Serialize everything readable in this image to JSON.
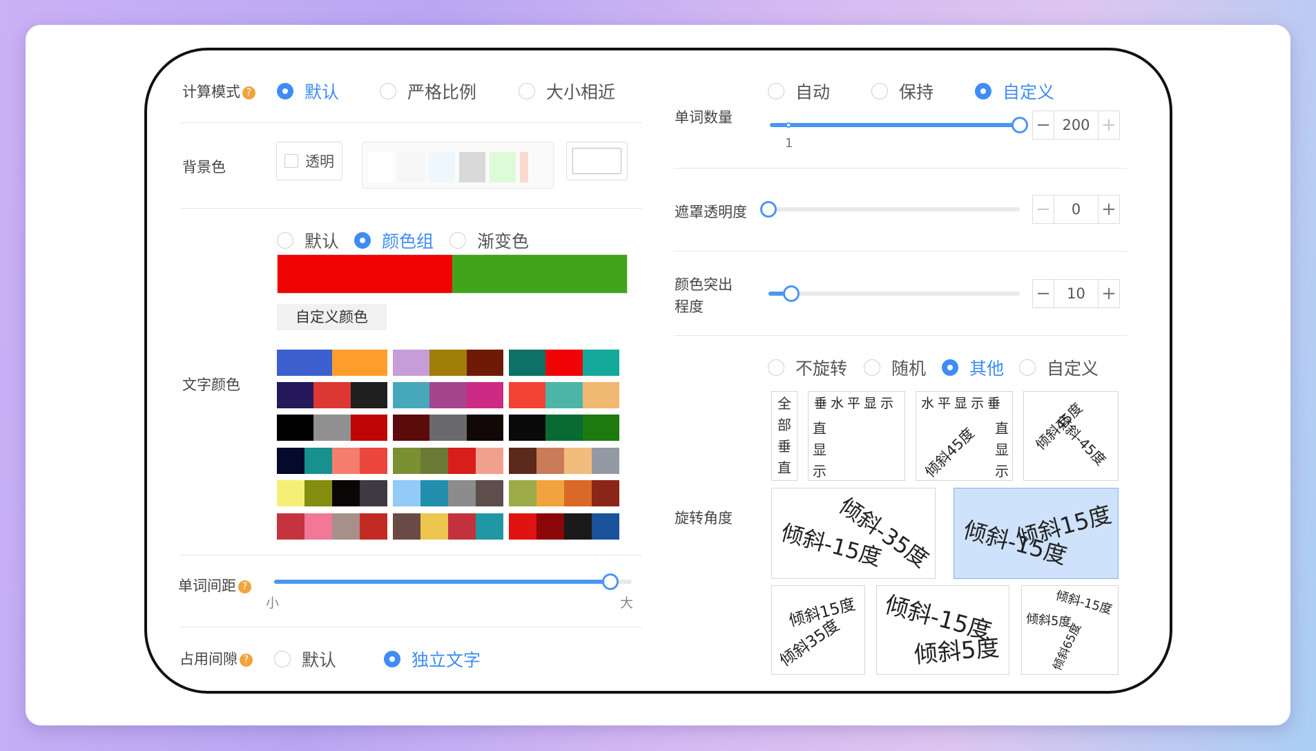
{
  "calc_mode": {
    "label": "计算模式",
    "options": [
      {
        "label": "默认",
        "selected": true
      },
      {
        "label": "严格比例",
        "selected": false
      },
      {
        "label": "大小相近",
        "selected": false
      }
    ]
  },
  "background": {
    "label": "背景色",
    "transparent_label": "透明",
    "swatches": [
      "#ffffff",
      "#f6f6f6",
      "#eef7fd",
      "#d9d9d9",
      "#ddfbd7",
      "#fbd9cf"
    ]
  },
  "text_color": {
    "label": "文字颜色",
    "options": [
      {
        "label": "默认",
        "selected": false
      },
      {
        "label": "颜色组",
        "selected": true
      },
      {
        "label": "渐变色",
        "selected": false
      }
    ],
    "current_colors": [
      "#f20303",
      "#40a51b"
    ],
    "custom_button": "自定义颜色",
    "palettes": [
      [
        "#3c5fcf",
        "#3c5fcf",
        "#ff9d2b",
        "#ff9d2b"
      ],
      [
        "#c79dd8",
        "#a07e08",
        "#6f1a06"
      ],
      [
        "#0e7168",
        "#f20306",
        "#14a99a"
      ],
      [
        "#25195c",
        "#dc3732",
        "#1f1f1f"
      ],
      [
        "#47a8bb",
        "#a4458e",
        "#cc2a85"
      ],
      [
        "#f34335",
        "#4cb5a7",
        "#f0b870"
      ],
      [
        "#010101",
        "#909090",
        "#bf0605"
      ],
      [
        "#5b0b0a",
        "#6a6a6c",
        "#120807"
      ],
      [
        "#0a0a0a",
        "#096b32",
        "#1d7a0e"
      ],
      [
        "#030a2c",
        "#17918d",
        "#f47d6e",
        "#ec473c"
      ],
      [
        "#7a9133",
        "#6b7a35",
        "#d81e1a",
        "#f1a08f"
      ],
      [
        "#5c2a1d",
        "#c97b5a",
        "#f2bd7c",
        "#949aa3"
      ],
      [
        "#f5ef77",
        "#848d0e",
        "#0b0606",
        "#3e3942"
      ],
      [
        "#91cbf6",
        "#218fad",
        "#8c8c8c",
        "#5d4d4b"
      ],
      [
        "#9cab48",
        "#f0a33e",
        "#da6826",
        "#8b2619"
      ],
      [
        "#c5333f",
        "#f17897",
        "#a69089",
        "#c12b24"
      ],
      [
        "#6a4a45",
        "#ecc64e",
        "#c4313c",
        "#1f98a3"
      ],
      [
        "#e11312",
        "#8b0608",
        "#1a1a1a",
        "#1a529c"
      ]
    ]
  },
  "word_spacing": {
    "label": "单词间距",
    "min_label": "小",
    "max_label": "大",
    "value_fraction": 0.94
  },
  "occupancy_gap": {
    "label": "占用间隙",
    "options": [
      {
        "label": "默认",
        "selected": false
      },
      {
        "label": "独立文字",
        "selected": true
      }
    ]
  },
  "word_count": {
    "label": "单词数量",
    "options": [
      {
        "label": "自动",
        "selected": false
      },
      {
        "label": "保持",
        "selected": false
      },
      {
        "label": "自定义",
        "selected": true
      }
    ],
    "slider_min_label": "1",
    "value": "200",
    "value_fraction": 1.0
  },
  "mask_opacity": {
    "label": "遮罩透明度",
    "value": "0",
    "value_fraction": 0.0
  },
  "color_emphasis": {
    "label_line1": "颜色突出",
    "label_line2": "程度",
    "value": "10",
    "value_fraction": 0.09
  },
  "rotation": {
    "label": "旋转角度",
    "options": [
      {
        "label": "不旋转",
        "selected": false
      },
      {
        "label": "随机",
        "selected": false
      },
      {
        "label": "其他",
        "selected": true
      },
      {
        "label": "自定义",
        "selected": false
      }
    ],
    "p1": [
      "全",
      "部",
      "垂",
      "直"
    ],
    "p2_h": "垂水平显示",
    "p2_v": [
      "直",
      "显",
      "示"
    ],
    "p3_h": "水平显示垂",
    "p3_d": "倾斜45度",
    "p3_v": [
      "直",
      "显",
      "示"
    ],
    "p4_a": "倾斜45度",
    "p4_b": "倾斜-45度",
    "p5_a": "倾斜-35度",
    "p5_b": "倾斜-15度",
    "p6_a": "倾斜15度",
    "p6_b": "倾斜-15度",
    "p7_a": "倾斜15度",
    "p7_b": "倾斜35度",
    "p8_a": "倾斜-15度",
    "p8_b": "倾斜5度",
    "p9_a": "倾斜-15度",
    "p9_b": "倾斜5度",
    "p9_c": "倾斜65度"
  },
  "colors": {
    "accent": "#3f8cf3",
    "help_icon": "#f3a33c",
    "selected_preset_bg": "#cfe2fb"
  }
}
